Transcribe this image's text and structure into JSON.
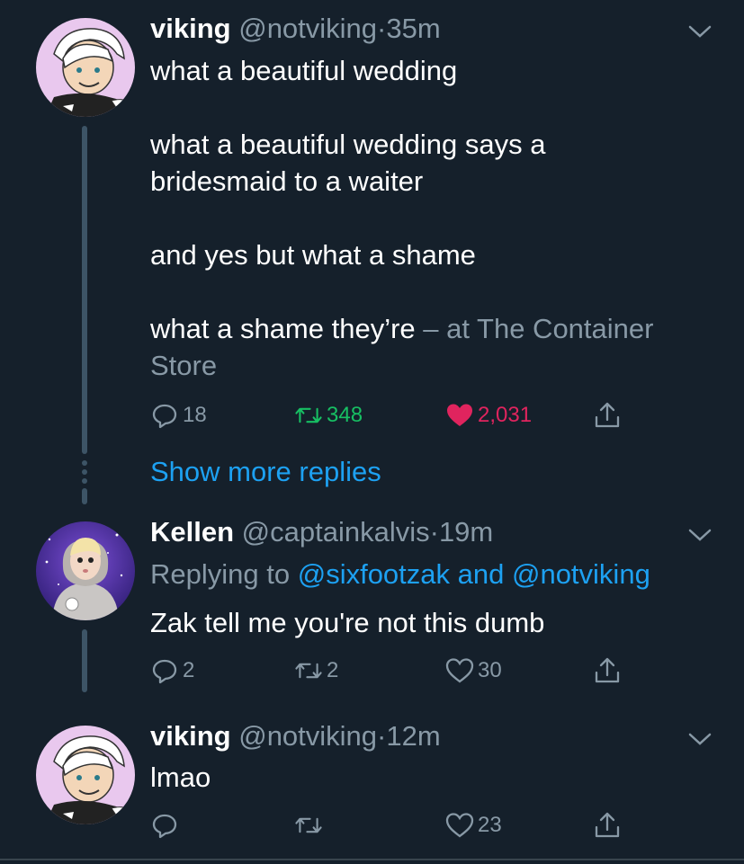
{
  "tweets": [
    {
      "name": "viking",
      "handle": "@notviking",
      "dot": "·",
      "time": "35m",
      "lines": [
        "what a beautiful wedding",
        "",
        "what a beautiful wedding says a",
        "bridesmaid to a waiter",
        "",
        "and yes but what a shame",
        "",
        "what a shame they’re",
        "Store"
      ],
      "location_prefix": " – at The Container",
      "replies": "18",
      "retweets": "348",
      "likes": "2,031"
    },
    {
      "name": "Kellen",
      "handle": "@captainkalvis",
      "dot": "·",
      "time": "19m",
      "replying_prefix": "Replying to ",
      "replying_user1": "@sixfootzak",
      "replying_and": " and ",
      "replying_user2": "@notviking",
      "text": "Zak tell me you're not this dumb",
      "replies": "2",
      "retweets": "2",
      "likes": "30"
    },
    {
      "name": "viking",
      "handle": "@notviking",
      "dot": "·",
      "time": "12m",
      "text": "lmao",
      "likes": "23"
    }
  ],
  "show_more_replies": "Show more replies",
  "colors": {
    "background": "#15202b",
    "muted": "#8899a6",
    "link": "#1da1f2",
    "retweet_active": "#17bf63",
    "like_active": "#e0245e",
    "thread_line": "#3d5466"
  },
  "icons": [
    "reply-icon",
    "retweet-icon",
    "like-icon",
    "share-icon",
    "chevron-down-icon"
  ]
}
